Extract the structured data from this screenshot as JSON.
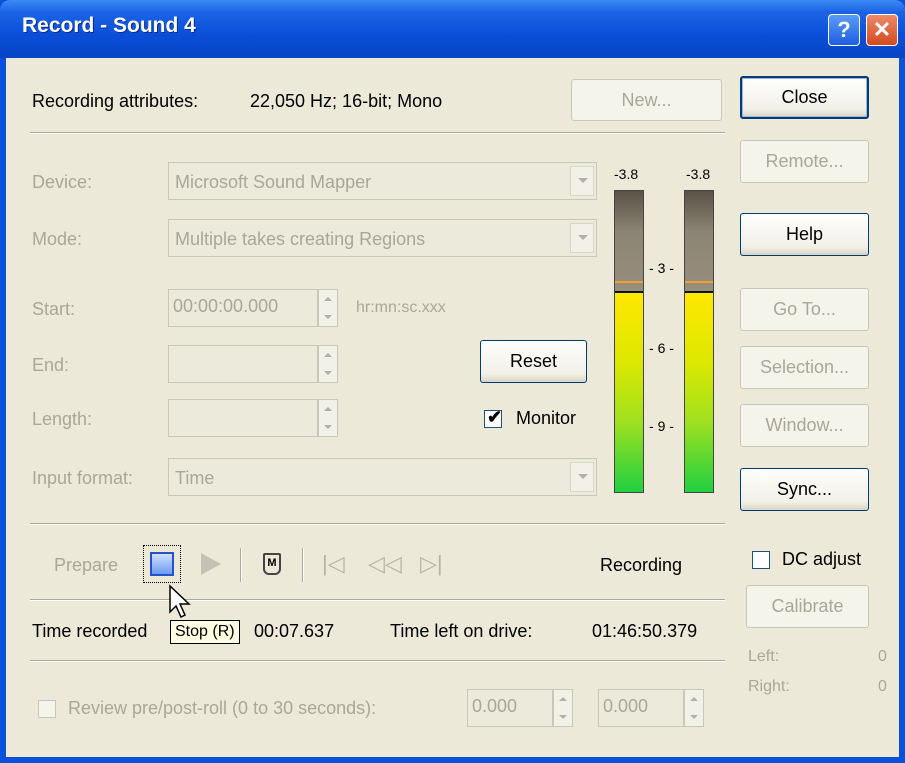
{
  "window": {
    "title": "Record - Sound 4",
    "help_glyph": "?",
    "close_glyph": "✕"
  },
  "attributes": {
    "label": "Recording attributes:",
    "value": "22,050 Hz; 16-bit; Mono"
  },
  "buttons": {
    "new": "New...",
    "close": "Close",
    "remote": "Remote...",
    "help": "Help",
    "goto": "Go To...",
    "selection": "Selection...",
    "window": "Window...",
    "sync": "Sync...",
    "calibrate": "Calibrate",
    "reset": "Reset"
  },
  "form": {
    "device_label": "Device:",
    "device_value": "Microsoft Sound Mapper",
    "mode_label": "Mode:",
    "mode_value": "Multiple takes creating Regions",
    "start_label": "Start:",
    "start_value": "00:00:00.000",
    "start_hint": "hr:mn:sc.xxx",
    "end_label": "End:",
    "end_value": "",
    "length_label": "Length:",
    "length_value": "",
    "input_format_label": "Input format:",
    "input_format_value": "Time",
    "monitor_label": "Monitor",
    "monitor_checked": "✔"
  },
  "meters": {
    "left_peak": "-3.8",
    "right_peak": "-3.8",
    "scale": [
      "3",
      "6",
      "9"
    ],
    "left_level": 0.66,
    "right_level": 0.66
  },
  "transport": {
    "prepare": "Prepare",
    "status": "Recording",
    "stop_icon": "stop-icon",
    "play_icon": "play-icon",
    "marker_icon": "marker-icon",
    "marker_glyph": "M"
  },
  "dc_adjust": {
    "label": "DC adjust",
    "checked": false
  },
  "times": {
    "recorded_label": "Time recorded",
    "recorded_value": "00:07.637",
    "left_label": "Time left on drive:",
    "left_value": "01:46:50.379"
  },
  "tooltip": "Stop (R)",
  "calibration": {
    "left_label": "Left:",
    "left_value": "0",
    "right_label": "Right:",
    "right_value": "0"
  },
  "review": {
    "label": "Review pre/post-roll (0 to 30 seconds):",
    "pre_value": "0.000",
    "post_value": "0.000"
  }
}
